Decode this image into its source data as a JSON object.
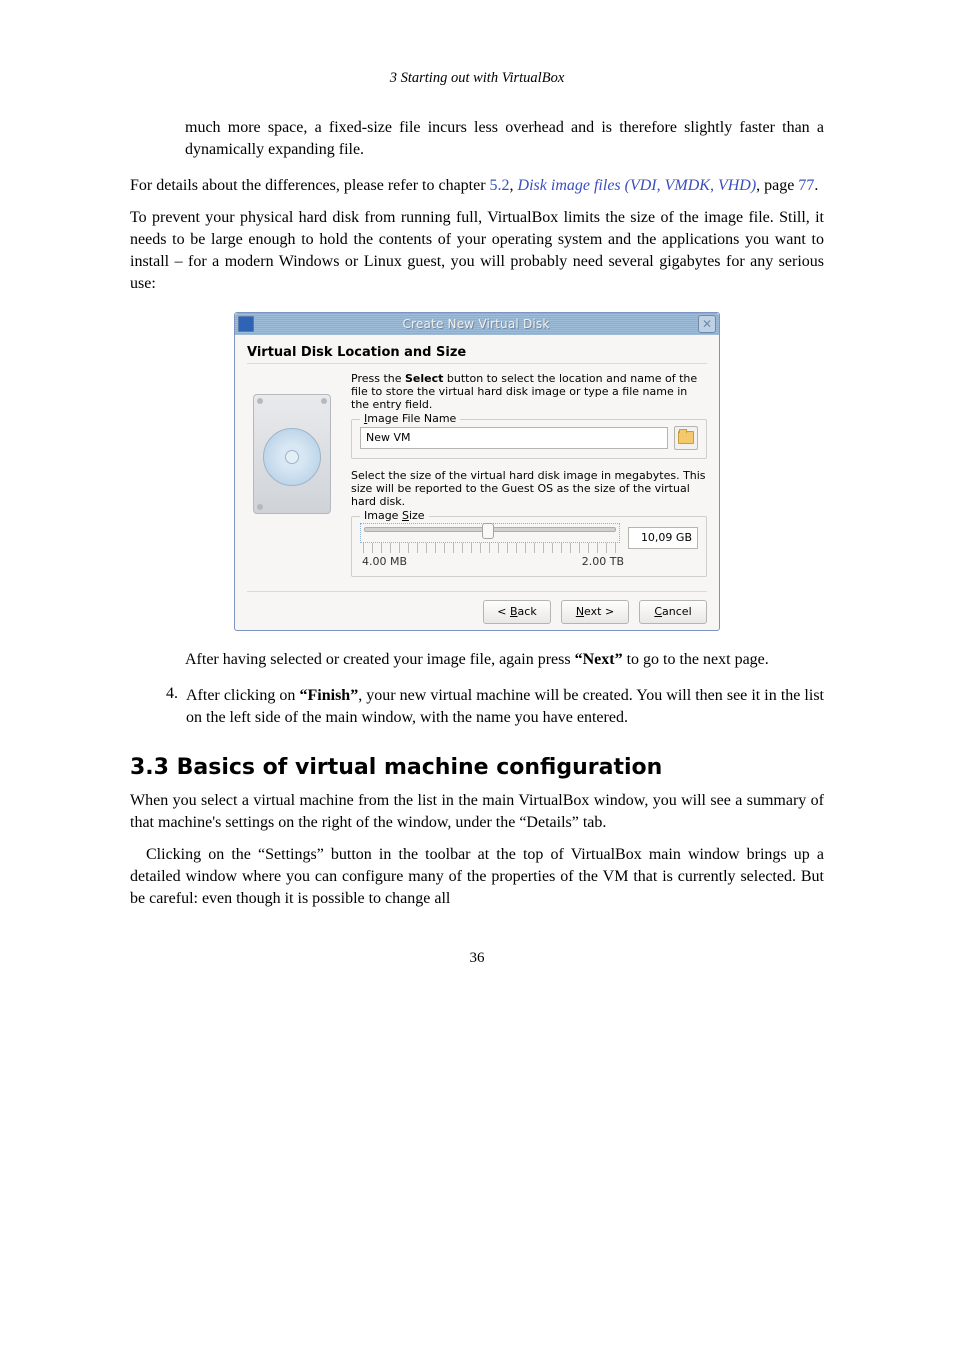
{
  "running_head": "3 Starting out with VirtualBox",
  "top_block": "much more space, a fixed-size file incurs less overhead and is therefore slightly faster than a dynamically expanding file.",
  "para_details": {
    "lead": "For details about the differences, please refer to chapter ",
    "chap_ref": "5.2",
    "sep": ", ",
    "link_text": "Disk image files (VDI, VMDK, VHD)",
    "page_lead": ", page ",
    "page_ref": "77",
    "tail": "."
  },
  "para_prevent": "To prevent your physical hard disk from running full, VirtualBox limits the size of the image file. Still, it needs to be large enough to hold the contents of your operating system and the applications you want to install – for a modern Windows or Linux guest, you will probably need several gigabytes for any serious use:",
  "dialog": {
    "title": "Create New Virtual Disk",
    "section": "Virtual Disk Location and Size",
    "instr1_a": "Press the ",
    "instr1_b": "Select",
    "instr1_c": " button to select the location and name of the file to store the virtual hard disk image or type a file name in the entry field.",
    "legend_name": "Image File Name",
    "file_value": "New VM",
    "instr2": "Select the size of the virtual hard disk image in megabytes. This size will be reported to the Guest OS as the size of the virtual hard disk.",
    "legend_size": "Image Size",
    "min_label": "4.00 MB",
    "max_label": "2.00 TB",
    "size_value": "10,09 GB",
    "btn_back": "< Back",
    "btn_next": "Next >",
    "btn_cancel": "Cancel"
  },
  "para_after1_a": "After having selected or created your image file, again press ",
  "para_after1_b": "“Next”",
  "para_after1_c": " to go to the next page.",
  "item4_a": "After clicking on ",
  "item4_b": "“Finish”",
  "item4_c": ", your new virtual machine will be created. You will then see it in the list on the left side of the main window, with the name you have entered.",
  "heading": "3.3 Basics of virtual machine configuration",
  "sec_para1": "When you select a virtual machine from the list in the main VirtualBox window, you will see a summary of that machine's settings on the right of the window, under the “Details” tab.",
  "sec_para2": "Clicking on the “Settings” button in the toolbar at the top of VirtualBox main window brings up a detailed window where you can configure many of the properties of the VM that is currently selected. But be careful: even though it is possible to change all",
  "page_number": "36"
}
